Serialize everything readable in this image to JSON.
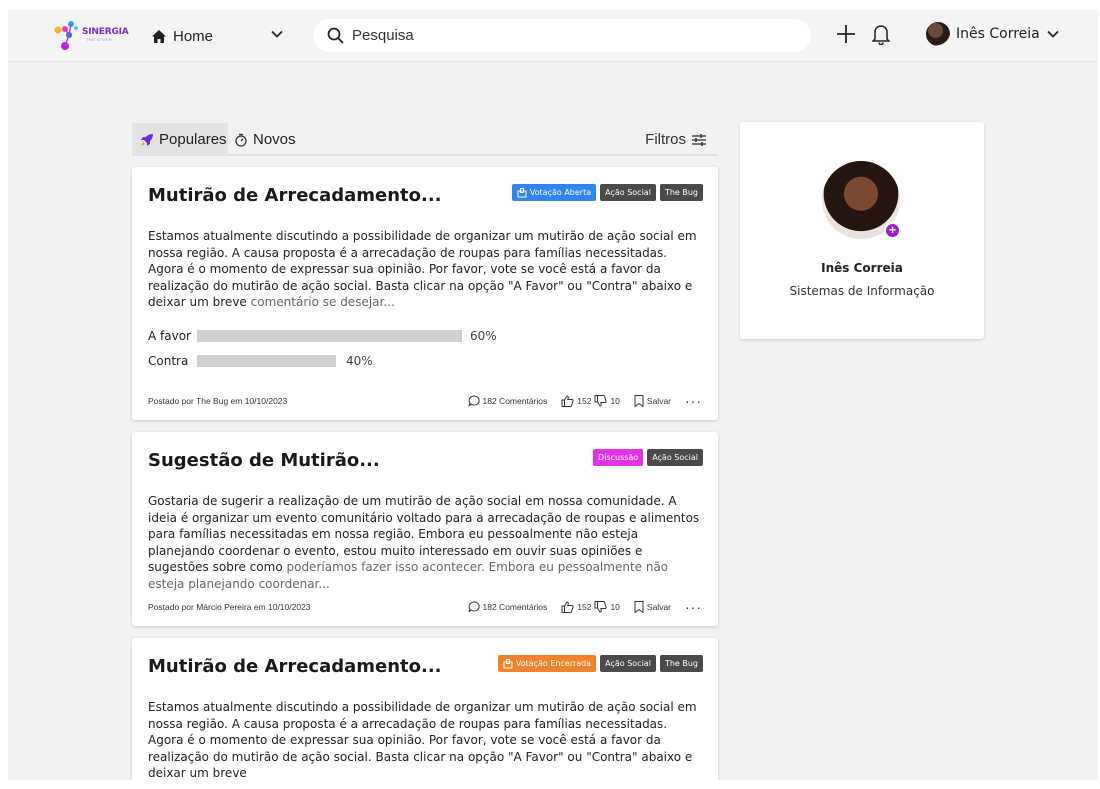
{
  "header": {
    "logo_text": "SINERGIA",
    "logo_subtext": "THE GIVER",
    "home_label": "Home",
    "search_placeholder": "Pesquisa",
    "user_name": "Inês Correia"
  },
  "feed": {
    "tabs": [
      {
        "label": "Populares",
        "icon": "rocket-icon",
        "active": true
      },
      {
        "label": "Novos",
        "icon": "timer-icon",
        "active": false
      }
    ],
    "filters_label": "Filtros"
  },
  "posts": [
    {
      "title": "Mutirão de Arrecadamento...",
      "status_tag": "Votação Aberta",
      "tags": [
        "Ação Social",
        "The Bug"
      ],
      "body": "Estamos atualmente discutindo a possibilidade de organizar um mutirão de ação social em nossa região. A causa proposta é a arrecadação de roupas para famílias necessitadas. Agora é o momento de expressar sua opinião. Por favor, vote se você está a favor da realização do mutirão de ação social. Basta clicar na opção \"A Favor\" ou \"Contra\" abaixo e deixar um breve",
      "body_fade": "comentário se desejar...",
      "votes": [
        {
          "label": "A favor",
          "percent": "60%",
          "fraction": 0.6
        },
        {
          "label": "Contra",
          "percent": "40%",
          "fraction": 0.4
        }
      ],
      "posted_by": "Postado por The Bug em 10/10/2023",
      "comments": "182 Comentários",
      "likes": "152",
      "dislikes": "10",
      "save_label": "Salvar"
    },
    {
      "title": "Sugestão de Mutirão...",
      "status_tag": "Discussão",
      "tags": [
        "Ação Social"
      ],
      "body": "Gostaria de sugerir a realização de um mutirão de ação social em nossa comunidade. A ideia é organizar um evento comunitário voltado para a arrecadação de roupas e alimentos para famílias necessitadas em nossa região. Embora eu pessoalmente não esteja planejando coordenar o evento, estou muito interessado em ouvir suas opiniões e sugestões sobre como",
      "body_fade": "poderíamos fazer isso acontecer. Embora eu pessoalmente não esteja planejando coordenar...",
      "posted_by": "Postado por Márcio Pereira em 10/10/2023",
      "comments": "182 Comentários",
      "likes": "152",
      "dislikes": "10",
      "save_label": "Salvar"
    },
    {
      "title": "Mutirão de Arrecadamento...",
      "status_tag": "Votação Encerrada",
      "tags": [
        "Ação Social",
        "The Bug"
      ],
      "body": "Estamos atualmente discutindo a possibilidade de organizar um mutirão de ação social em nossa região. A causa proposta é a arrecadação de roupas para famílias necessitadas. Agora é o momento de expressar sua opinião. Por favor, vote se você está a favor da realização do mutirão de ação social. Basta clicar na opção \"A Favor\" ou \"Contra\" abaixo e deixar um breve"
    }
  ],
  "profile": {
    "name": "Inês Correia",
    "course": "Sistemas de Informação"
  },
  "colors": {
    "tag_open_vote": "#2f86f0",
    "tag_discussion": "#e233e8",
    "tag_closed_vote": "#f0832a",
    "tag_dark": "#4a4a4a",
    "brand": "#7a2ec8"
  }
}
